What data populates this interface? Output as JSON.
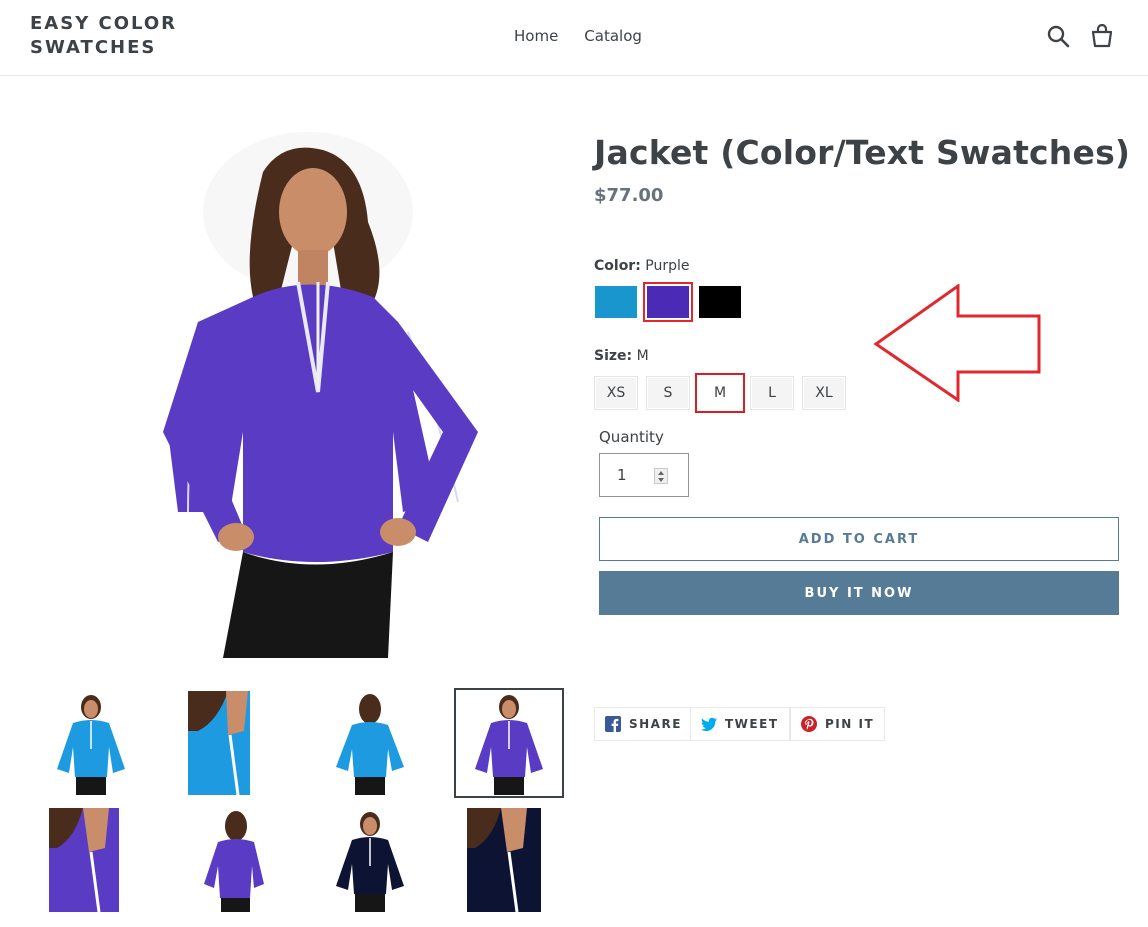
{
  "header": {
    "logo": "EASY COLOR SWATCHES",
    "nav": [
      "Home",
      "Catalog"
    ],
    "search_icon": "search-icon",
    "cart_icon": "cart-icon"
  },
  "product": {
    "title": "Jacket (Color/Text Swatches)",
    "price": "$77.00",
    "color": {
      "label": "Color:",
      "selected": "Purple",
      "swatches": [
        {
          "name": "Blue",
          "hex": "#1a96cf"
        },
        {
          "name": "Purple",
          "hex": "#4b2bb5"
        },
        {
          "name": "Black",
          "hex": "#000000"
        }
      ]
    },
    "size": {
      "label": "Size:",
      "selected": "M",
      "options": [
        "XS",
        "S",
        "M",
        "L",
        "XL"
      ]
    },
    "quantity": {
      "label": "Quantity",
      "value": "1"
    },
    "add_to_cart": "ADD TO CART",
    "buy_now": "BUY IT NOW"
  },
  "share": {
    "facebook": "SHARE",
    "twitter": "TWEET",
    "pinterest": "PIN IT"
  },
  "colors": {
    "accent": "#557b97",
    "highlight": "#e0282e",
    "purple": "#4b2bb5",
    "blue": "#1a96cf",
    "navy": "#0d1433"
  }
}
